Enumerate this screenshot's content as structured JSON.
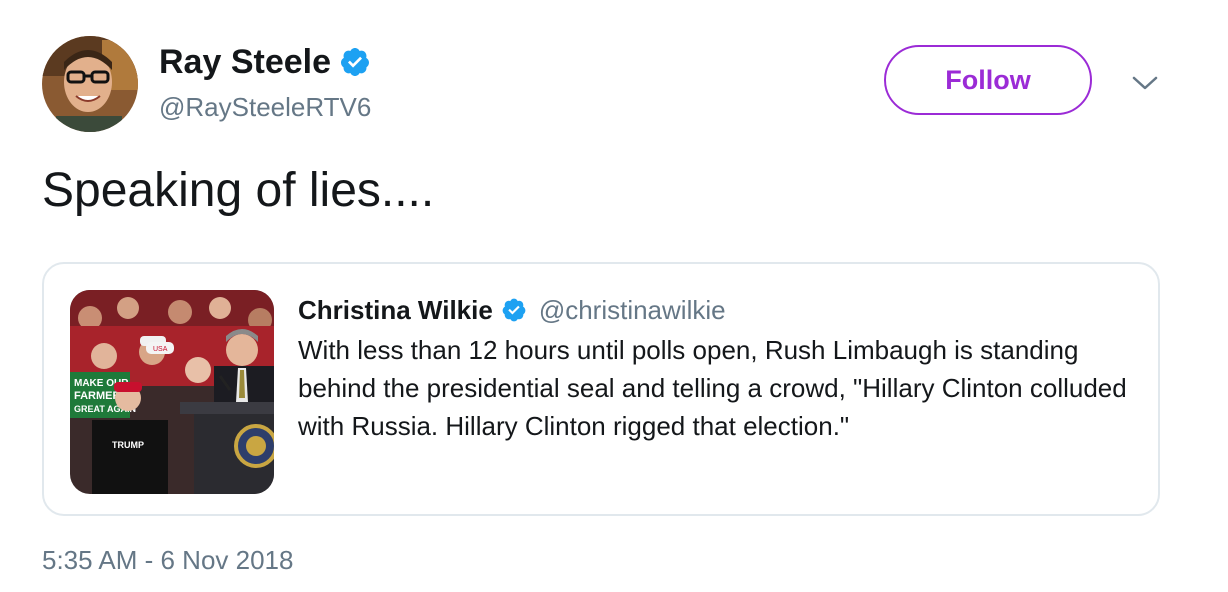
{
  "author": {
    "name": "Ray Steele",
    "handle": "@RaySteeleRTV6",
    "verified": true
  },
  "follow_label": "Follow",
  "tweet_text": "Speaking of lies....",
  "quoted": {
    "name": "Christina Wilkie",
    "handle": "@christinawilkie",
    "verified": true,
    "text": "With less than 12 hours until polls open, Rush Limbaugh is standing behind the presidential seal and telling a crowd, \"Hillary Clinton colluded with Russia. Hillary Clinton rigged that election.\"",
    "media_sign_text": [
      "MAKE OUR",
      "FARMERS",
      "GREAT AGAIN"
    ],
    "media_shirt_text": "TRUMP",
    "media_hat_text": "USA"
  },
  "timestamp": "5:35 AM - 6 Nov 2018",
  "colors": {
    "accent": "#9b2bd6",
    "verified": "#1da1f2",
    "secondary_text": "#657786",
    "border": "#e1e8ed"
  },
  "icons": {
    "verified": "verified-badge-icon",
    "more": "chevron-down-icon"
  }
}
